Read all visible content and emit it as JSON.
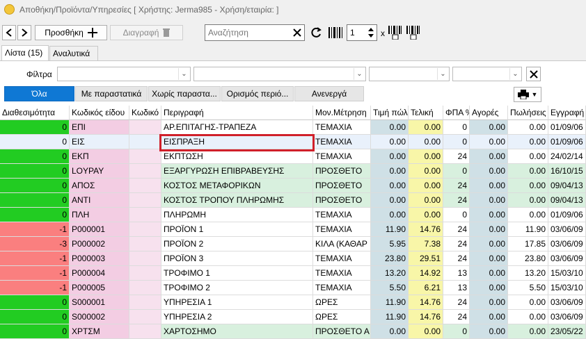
{
  "window": {
    "title": "Αποθήκη/Προϊόντα/Υπηρεσίες   [ Χρήστης: Jerma985 - Χρήση/εταιρία: ]"
  },
  "toolbar": {
    "add_label": "Προσθήκη",
    "delete_label": "Διαγραφή",
    "search_placeholder": "Αναζήτηση",
    "search_value": "",
    "quantity_value": "1",
    "multiply_label": "x"
  },
  "tabs": [
    {
      "label": "Λίστα (15)",
      "active": true
    },
    {
      "label": "Αναλυτικά",
      "active": false
    }
  ],
  "filters": {
    "label": "Φίλτρα"
  },
  "quick_filters": [
    {
      "label": "Όλα",
      "active": true
    },
    {
      "label": "Με παραστατικά",
      "active": false
    },
    {
      "label": "Χωρίς παραστα...",
      "active": false
    },
    {
      "label": "Ορισμός περιό...",
      "active": false
    },
    {
      "label": "Ανενεργά",
      "active": false
    }
  ],
  "table": {
    "columns": [
      "Διαθεσιμότητα",
      "Κωδικός είδου",
      "Κωδικό",
      "Περιγραφή",
      "Μον.Μέτρηση",
      "Τιμή πώλ",
      "Τελική",
      "ΦΠΑ %",
      "Αγορές",
      "Πωλήσεις",
      "Εγγραφή"
    ],
    "rows": [
      {
        "avail": "0",
        "code": "ΕΠΙ",
        "code2": "",
        "desc": "ΑΡ.ΕΠΙΤΑΓΗΣ-ΤΡΑΠΕΖΑ",
        "unit": "ΤΕΜΑΧΙΑ",
        "price": "0.00",
        "final": "0.00",
        "vat": "0",
        "buys": "0.00",
        "sales": "0.00",
        "date": "01/09/06",
        "avail_color": "#22cc22",
        "unit_color": "#ffffff"
      },
      {
        "avail": "0",
        "code": "ΕΙΣ",
        "code2": "",
        "desc": "ΕΙΣΠΡΑΞΗ",
        "unit": "ΤΕΜΑΧΙΑ",
        "price": "0.00",
        "final": "0.00",
        "vat": "0",
        "buys": "0.00",
        "sales": "0.00",
        "date": "01/09/06",
        "avail_color": "#e9f1fb",
        "unit_color": "#e9f1fb",
        "selected": true
      },
      {
        "avail": "0",
        "code": "ΕΚΠ",
        "code2": "",
        "desc": "ΕΚΠΤΩΣΗ",
        "unit": "ΤΕΜΑΧΙΑ",
        "price": "0.00",
        "final": "0.00",
        "vat": "24",
        "buys": "0.00",
        "sales": "0.00",
        "date": "24/02/14",
        "avail_color": "#22cc22",
        "unit_color": "#ffffff"
      },
      {
        "avail": "0",
        "code": "LOYPAY",
        "code2": "",
        "desc": "ΕΞΑΡΓΥΡΩΣΗ ΕΠΙΒΡΑΒΕΥΣΗΣ",
        "unit": "ΠΡΟΣΘΕΤΟ",
        "price": "0.00",
        "final": "0.00",
        "vat": "0",
        "buys": "0.00",
        "sales": "0.00",
        "date": "16/10/15",
        "avail_color": "#22cc22",
        "unit_color": "#d8f0de"
      },
      {
        "avail": "0",
        "code": "ΑΠΟΣ",
        "code2": "",
        "desc": "ΚΟΣΤΟΣ ΜΕΤΑΦΟΡΙΚΩΝ",
        "unit": "ΠΡΟΣΘΕΤΟ",
        "price": "0.00",
        "final": "0.00",
        "vat": "24",
        "buys": "0.00",
        "sales": "0.00",
        "date": "09/04/13",
        "avail_color": "#22cc22",
        "unit_color": "#d8f0de"
      },
      {
        "avail": "0",
        "code": "ΑΝΤΙ",
        "code2": "",
        "desc": "ΚΟΣΤΟΣ ΤΡΟΠΟΥ ΠΛΗΡΩΜΗΣ",
        "unit": "ΠΡΟΣΘΕΤΟ",
        "price": "0.00",
        "final": "0.00",
        "vat": "24",
        "buys": "0.00",
        "sales": "0.00",
        "date": "09/04/13",
        "avail_color": "#22cc22",
        "unit_color": "#d8f0de"
      },
      {
        "avail": "0",
        "code": "ΠΛΗ",
        "code2": "",
        "desc": "ΠΛΗΡΩΜΗ",
        "unit": "ΤΕΜΑΧΙΑ",
        "price": "0.00",
        "final": "0.00",
        "vat": "0",
        "buys": "0.00",
        "sales": "0.00",
        "date": "01/09/06",
        "avail_color": "#22cc22",
        "unit_color": "#ffffff"
      },
      {
        "avail": "-1",
        "code": "P000001",
        "code2": "",
        "desc": "ΠΡΟΪΟΝ 1",
        "unit": "ΤΕΜΑΧΙΑ",
        "price": "11.90",
        "final": "14.76",
        "vat": "24",
        "buys": "0.00",
        "sales": "11.90",
        "date": "03/06/09",
        "avail_color": "#fa7f7f",
        "unit_color": "#ffffff"
      },
      {
        "avail": "-3",
        "code": "P000002",
        "code2": "",
        "desc": "ΠΡΟΪΟΝ 2",
        "unit": "ΚΙΛΑ (ΚΑΘΑΡ",
        "price": "5.95",
        "final": "7.38",
        "vat": "24",
        "buys": "0.00",
        "sales": "17.85",
        "date": "03/06/09",
        "avail_color": "#fa7f7f",
        "unit_color": "#ffffff"
      },
      {
        "avail": "-1",
        "code": "P000003",
        "code2": "",
        "desc": "ΠΡΟΪΟΝ 3",
        "unit": "ΤΕΜΑΧΙΑ",
        "price": "23.80",
        "final": "29.51",
        "vat": "24",
        "buys": "0.00",
        "sales": "23.80",
        "date": "03/06/09",
        "avail_color": "#fa7f7f",
        "unit_color": "#ffffff"
      },
      {
        "avail": "-1",
        "code": "P000004",
        "code2": "",
        "desc": "ΤΡΟΦΙΜΟ 1",
        "unit": "ΤΕΜΑΧΙΑ",
        "price": "13.20",
        "final": "14.92",
        "vat": "13",
        "buys": "0.00",
        "sales": "13.20",
        "date": "15/03/10",
        "avail_color": "#fa7f7f",
        "unit_color": "#ffffff"
      },
      {
        "avail": "-1",
        "code": "P000005",
        "code2": "",
        "desc": "ΤΡΟΦΙΜΟ 2",
        "unit": "ΤΕΜΑΧΙΑ",
        "price": "5.50",
        "final": "6.21",
        "vat": "13",
        "buys": "0.00",
        "sales": "5.50",
        "date": "15/03/10",
        "avail_color": "#fa7f7f",
        "unit_color": "#ffffff"
      },
      {
        "avail": "0",
        "code": "S000001",
        "code2": "",
        "desc": "ΥΠΗΡΕΣΙΑ 1",
        "unit": "ΩΡΕΣ",
        "price": "11.90",
        "final": "14.76",
        "vat": "24",
        "buys": "0.00",
        "sales": "0.00",
        "date": "03/06/09",
        "avail_color": "#22cc22",
        "unit_color": "#ffffff"
      },
      {
        "avail": "0",
        "code": "S000002",
        "code2": "",
        "desc": "ΥΠΗΡΕΣΙΑ 2",
        "unit": "ΩΡΕΣ",
        "price": "11.90",
        "final": "14.76",
        "vat": "24",
        "buys": "0.00",
        "sales": "0.00",
        "date": "03/06/09",
        "avail_color": "#22cc22",
        "unit_color": "#ffffff"
      },
      {
        "avail": "0",
        "code": "ΧΡΤΣΜ",
        "code2": "",
        "desc": "ΧΑΡΤΟΣΗΜΟ",
        "unit": "ΠΡΟΣΘΕΤΟ Α",
        "price": "0.00",
        "final": "0.00",
        "vat": "0",
        "buys": "0.00",
        "sales": "0.00",
        "date": "23/05/22",
        "avail_color": "#22cc22",
        "unit_color": "#d8f0de"
      }
    ]
  },
  "colors": {
    "code_bg": "#f3cde3",
    "code2_bg": "#f7e1ee",
    "price_bg": "#cfe0e6",
    "final_bg": "#f8f6a8",
    "buys_bg": "#cfe0e6",
    "selection_frame": "#d0202a"
  }
}
